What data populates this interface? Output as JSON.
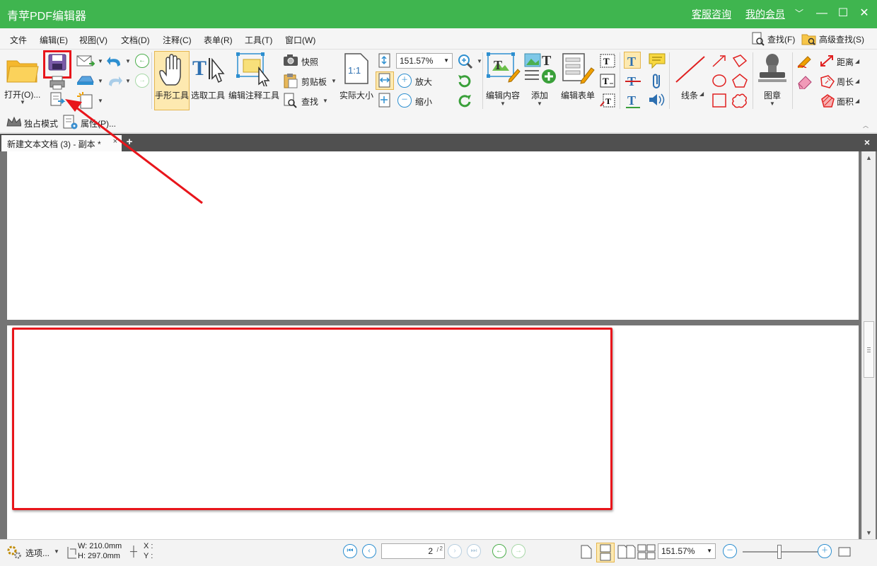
{
  "app": {
    "title": "青苹PDF编辑器",
    "service_link": "客服咨询",
    "member_link": "我的会员"
  },
  "menu": {
    "items": [
      "文件",
      "编辑(E)",
      "视图(V)",
      "文档(D)",
      "注释(C)",
      "表单(R)",
      "工具(T)",
      "窗口(W)"
    ],
    "find": "查找(F)",
    "advanced_find": "高级查找(S)"
  },
  "ribbon": {
    "open": "打开(O)...",
    "hand_tool": "手形工具",
    "select_tool": "选取工具",
    "edit_annot_tool": "编辑注释工具",
    "snapshot": "快照",
    "clipboard": "剪贴板",
    "find": "查找",
    "actual_size": "实际大小",
    "zoom_value": "151.57%",
    "zoom_in": "放大",
    "zoom_out": "缩小",
    "edit_content": "编辑内容",
    "add": "添加",
    "edit_form": "编辑表单",
    "lines": "线条",
    "stamp": "图章",
    "distance": "距离",
    "perimeter": "周长",
    "area": "面积"
  },
  "toolbar2": {
    "exclusive_mode": "独占模式",
    "properties": "属性(P)..."
  },
  "tabs": {
    "active": "新建文本文档 (3) - 副本 *",
    "close": "×",
    "add": "+"
  },
  "status": {
    "options": "选项...",
    "width": "W: 210.0mm",
    "height": "H: 297.0mm",
    "x": "X :",
    "y": "Y :",
    "page_current": "2",
    "page_total": "2",
    "zoom": "151.57%"
  },
  "colors": {
    "titlebar": "#3fb54f",
    "highlight": "#e8151b",
    "accent_blue": "#2d8fd0"
  }
}
